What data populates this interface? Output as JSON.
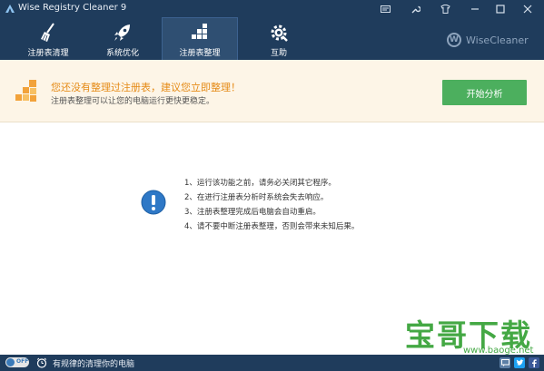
{
  "window": {
    "title": "Wise Registry Cleaner 9"
  },
  "toolbar": {
    "tabs": [
      {
        "label": "注册表清理",
        "icon": "broom-icon"
      },
      {
        "label": "系统优化",
        "icon": "rocket-icon"
      },
      {
        "label": "注册表整理",
        "icon": "defrag-icon",
        "active": true
      },
      {
        "label": "互助",
        "icon": "gear-wrench-icon"
      }
    ],
    "brand": "WiseCleaner",
    "brand_mark": "W"
  },
  "banner": {
    "headline": "您还没有整理过注册表，建议您立即整理！",
    "subline": "注册表整理可以让您的电脑运行更快更稳定。",
    "start_button": "开始分析"
  },
  "notes": [
    "1、运行该功能之前，请务必关闭其它程序。",
    "2、在进行注册表分析时系统会失去响应。",
    "3、注册表整理完成后电脑会自动重启。",
    "4、请不要中断注册表整理，否则会带来未知后果。"
  ],
  "watermark": {
    "text": "宝哥下载",
    "url": "www.baoge.net"
  },
  "statusbar": {
    "toggle_label": "OFF",
    "text": "有规律的清理你的电脑"
  },
  "colors": {
    "titlebar": "#1f3c5c",
    "accent_green": "#4caf5e",
    "headline_orange": "#e58a15",
    "info_blue": "#2e78c6"
  }
}
